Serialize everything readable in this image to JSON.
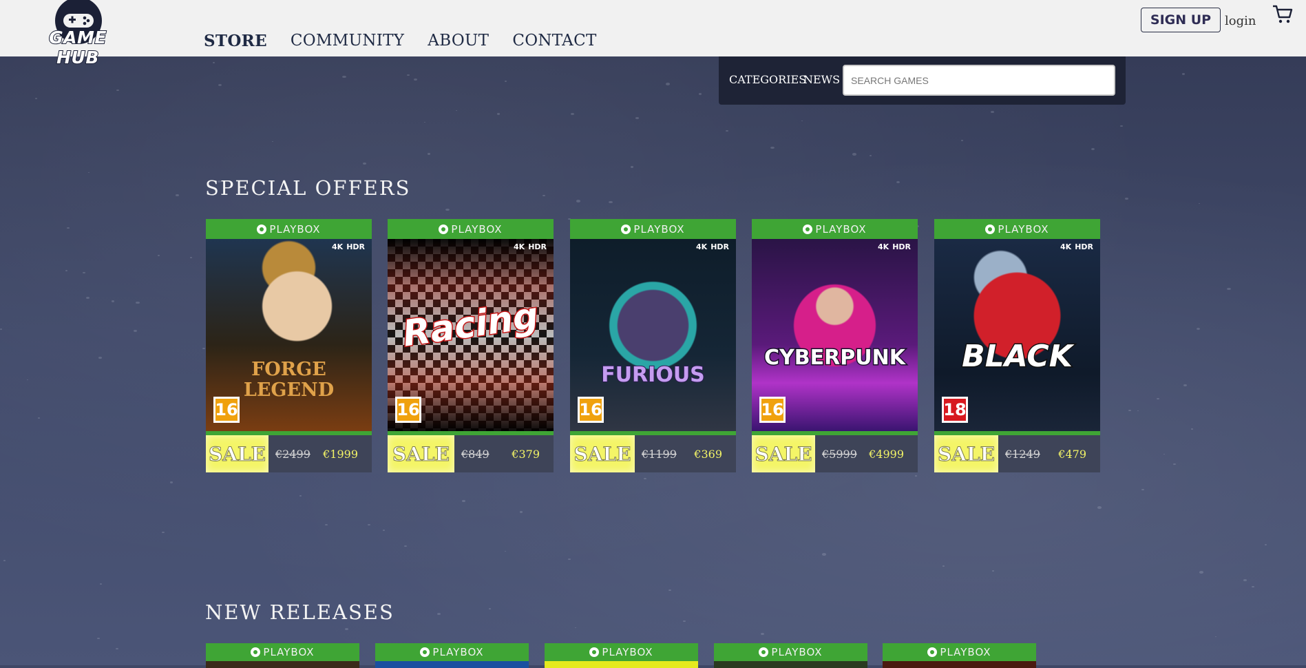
{
  "header": {
    "logo_text": "GAME HUB",
    "nav": [
      {
        "label": "STORE"
      },
      {
        "label": "COMMUNITY"
      },
      {
        "label": "ABOUT"
      },
      {
        "label": "CONTACT"
      }
    ],
    "signup_label": "SIGN UP",
    "login_label": "login",
    "cart_icon": "cart-icon"
  },
  "subnav": {
    "categories_label": "CATEGORIES",
    "news_label": "NEWS",
    "search_placeholder": "SEARCH GAMES"
  },
  "special_offers": {
    "title": "SPECIAL OFFERS",
    "cards": [
      {
        "platform": "PLAYBOX",
        "game": "FORGE LEGEND",
        "age": "16",
        "sale": "SALE",
        "old_price": "€2499",
        "new_price": "€1999"
      },
      {
        "platform": "PLAYBOX",
        "game": "Racing",
        "age": "16",
        "sale": "SALE",
        "old_price": "€849",
        "new_price": "€379"
      },
      {
        "platform": "PLAYBOX",
        "game": "FURIOUS",
        "age": "16",
        "sale": "SALE",
        "old_price": "€1199",
        "new_price": "€369"
      },
      {
        "platform": "PLAYBOX",
        "game": "CYBERPUNK",
        "age": "16",
        "sale": "SALE",
        "old_price": "€5999",
        "new_price": "€4999"
      },
      {
        "platform": "PLAYBOX",
        "game": "BLACK",
        "age": "18",
        "sale": "SALE",
        "old_price": "€1249",
        "new_price": "€479"
      }
    ],
    "badge_4k": "4K",
    "badge_hdr": "HDR"
  },
  "new_releases": {
    "title": "NEW RELEASES",
    "cards": [
      {
        "platform": "PLAYBOX"
      },
      {
        "platform": "PLAYBOX"
      },
      {
        "platform": "PLAYBOX"
      },
      {
        "platform": "PLAYBOX"
      },
      {
        "platform": "PLAYBOX"
      }
    ]
  },
  "colors": {
    "header_bg": "#f1f1f1",
    "platform_green": "#3fa535",
    "sale_yellow": "#f4f567",
    "subbar_bg": "#1e2336"
  }
}
